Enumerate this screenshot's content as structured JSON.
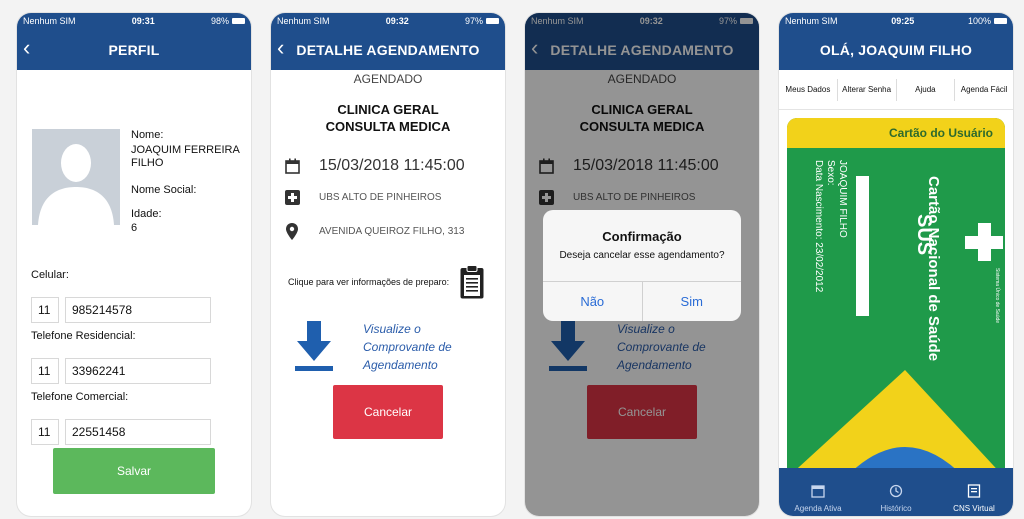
{
  "status_bars": [
    {
      "carrier": "Nenhum SIM",
      "time": "09:31",
      "battery": "98%"
    },
    {
      "carrier": "Nenhum SIM",
      "time": "09:32",
      "battery": "97%"
    },
    {
      "carrier": "Nenhum SIM",
      "time": "09:32",
      "battery": "97%"
    },
    {
      "carrier": "Nenhum SIM",
      "time": "09:25",
      "battery": "100%"
    }
  ],
  "profile": {
    "title": "PERFIL",
    "nome_label": "Nome:",
    "nome_value": "JOAQUIM FERREIRA FILHO",
    "nome_social_label": "Nome Social:",
    "idade_label": "Idade:",
    "idade_value": "6",
    "celular_label": "Celular:",
    "celular_ddd": "11",
    "celular_num": "985214578",
    "residencial_label": "Telefone Residencial:",
    "residencial_ddd": "11",
    "residencial_num": "33962241",
    "comercial_label": "Telefone Comercial:",
    "comercial_ddd": "11",
    "comercial_num": "22551458",
    "save_label": "Salvar"
  },
  "detail": {
    "title": "DETALHE AGENDAMENTO",
    "status": "AGENDADO",
    "clinic_line1": "CLINICA GERAL",
    "clinic_line2": "CONSULTA MEDICA",
    "datetime": "15/03/2018 11:45:00",
    "unit": "UBS ALTO DE PINHEIROS",
    "address": "AVENIDA QUEIROZ FILHO, 313",
    "prep_text": "Clique para ver informações de preparo:",
    "viz_line1": "Visualize o",
    "viz_line2": "Comprovante de",
    "viz_line3": "Agendamento",
    "cancel_label": "Cancelar"
  },
  "dialog": {
    "title": "Confirmação",
    "message": "Deseja cancelar esse agendamento?",
    "no_label": "Não",
    "yes_label": "Sim"
  },
  "home": {
    "title": "OLÁ, JOAQUIM FILHO",
    "tabs": [
      "Meus Dados",
      "Alterar Senha",
      "Ajuda",
      "Agenda Fácil"
    ],
    "card": {
      "header": "Cartão do Usuário",
      "sus": "SUS",
      "card_name": "Cartão Nacional de Saúde",
      "holder": "JOAQUIM FILHO",
      "sexo": "Sexo:",
      "nascimento": "Data Nascimento: 23/02/2012",
      "sistema": "Sistema Único de Saúde"
    },
    "bottom_nav": [
      "Agenda Ativa",
      "Histórico",
      "CNS Virtual"
    ]
  },
  "colors": {
    "primary": "#1f4e8c",
    "save": "#5cb85c",
    "cancel": "#dc3545",
    "card_green": "#1f9a4a",
    "card_yellow": "#f2d21a"
  }
}
